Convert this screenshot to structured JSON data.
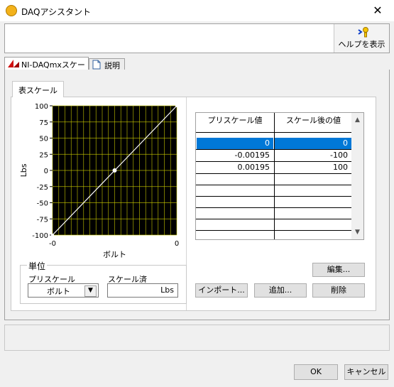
{
  "window": {
    "title": "DAQアシスタント"
  },
  "help": {
    "label": "ヘルプを表示"
  },
  "tabs": [
    {
      "label": "NI-DAQmxスケール",
      "icon": "ni-daqmx-icon"
    },
    {
      "label": "説明",
      "icon": "document-icon"
    }
  ],
  "inner_tab": {
    "label": "表スケール"
  },
  "chart_data": {
    "type": "line",
    "x": [
      -0.00195,
      0,
      0.00195
    ],
    "y": [
      -100,
      0,
      100
    ],
    "xlabel": "ボルト",
    "ylabel": "Lbs",
    "xlim": [
      -0.00195,
      0.00195
    ],
    "ylim": [
      -100,
      100
    ],
    "x_tick_labels": [
      "-0",
      "0"
    ],
    "y_ticks": [
      100,
      75,
      50,
      25,
      0,
      -25,
      -50,
      -75,
      -100
    ],
    "grid": true,
    "background": "#000000",
    "grid_color": "#c8c800",
    "line_color": "#ffffff"
  },
  "units": {
    "group_label": "単位",
    "prescaled_label": "プリスケール",
    "prescaled_value": "ボルト",
    "scaled_label": "スケール済",
    "scaled_value": "Lbs"
  },
  "table": {
    "headers": [
      "プリスケール値",
      "スケール後の値"
    ],
    "rows": [
      [
        "0",
        "0"
      ],
      [
        "-0.00195",
        "-100"
      ],
      [
        "0.00195",
        "100"
      ]
    ],
    "selected_row": 0,
    "selection_color": "#0078d7"
  },
  "buttons": {
    "edit": "編集...",
    "import": "インポート...",
    "add": "追加...",
    "delete": "削除",
    "ok": "OK",
    "cancel": "キャンセル"
  }
}
